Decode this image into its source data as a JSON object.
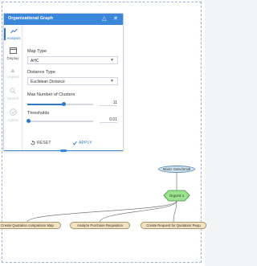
{
  "panel": {
    "title": "Organizational Graph",
    "header_icons": [
      "collapse-icon",
      "close-icon"
    ],
    "sidebar": [
      {
        "id": "analysis",
        "label": "Analysis",
        "icon": "trend-line-icon",
        "state": "active"
      },
      {
        "id": "display",
        "label": "Display",
        "icon": "display-window-icon",
        "state": "normal"
      },
      {
        "id": "legend",
        "label": "Legend",
        "icon": "legend-icon",
        "state": "disabled"
      },
      {
        "id": "search",
        "label": "Search",
        "icon": "search-icon",
        "state": "disabled"
      },
      {
        "id": "action",
        "label": "Action",
        "icon": "action-check-icon",
        "state": "disabled"
      }
    ],
    "map_type": {
      "label": "Map Type",
      "value": "AHC"
    },
    "distance_type": {
      "label": "Distance Type",
      "value": "Euclidean Distance"
    },
    "max_clusters": {
      "label": "Max Number of Clusters",
      "value": "11",
      "level": 0.55
    },
    "thresholds": {
      "label": "Thresholds",
      "value": "0.01",
      "level": 0.02
    },
    "buttons": {
      "reset": "RESET",
      "apply": "APPLY"
    }
  },
  "graph": {
    "nodes": [
      {
        "id": "n_resource",
        "type": "resource",
        "label": "Mainz Gotschmidt"
      },
      {
        "id": "n_orgunit",
        "type": "orgunit",
        "label": "OrgUnit 1"
      },
      {
        "id": "n_act1",
        "type": "activity",
        "label": "Create Quotation comparison Map"
      },
      {
        "id": "n_act2",
        "type": "activity",
        "label": "Analyze Purchase Requisition"
      },
      {
        "id": "n_act3",
        "type": "activity",
        "label": "Create Request for Quotation Requ"
      }
    ],
    "edges": [
      {
        "from": "n_resource",
        "to": "n_orgunit"
      },
      {
        "from": "n_orgunit",
        "to": "n_act1"
      },
      {
        "from": "n_orgunit",
        "to": "n_act2"
      },
      {
        "from": "n_orgunit",
        "to": "n_act3"
      }
    ],
    "colors": {
      "activity_fill": "#f2e3c0",
      "resource_fill": "#cfe4f2",
      "orgunit_fill": "#9be38f",
      "edge": "#777777"
    }
  }
}
